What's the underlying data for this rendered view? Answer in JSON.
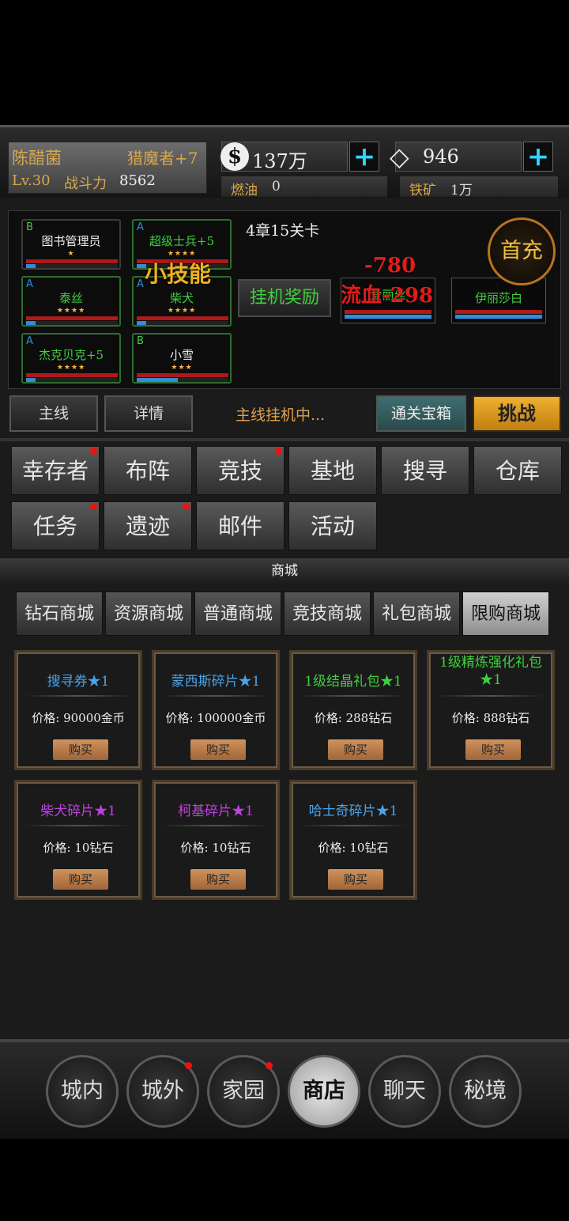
{
  "player": {
    "name": "陈醋菌",
    "title": "猎魔者+7",
    "level": "Lv.30",
    "power_label": "战斗力",
    "power_value": "8562"
  },
  "resources": {
    "money": "137万",
    "diamonds": "946",
    "fuel_label": "燃油",
    "fuel_value": "0",
    "iron_label": "铁矿",
    "iron_value": "1万"
  },
  "battle": {
    "stage": "4章15关卡",
    "idle_reward": "挂机奖励",
    "first_charge": "首充",
    "skill_popup": "小技能",
    "damage_popup": "-780",
    "bleed_popup": "流血-298",
    "heroes": [
      {
        "grade": "B",
        "name": "图书管理员",
        "stars": "★",
        "mp": 0.1
      },
      {
        "grade": "A",
        "name": "超级士兵+5",
        "stars": "★★★★",
        "mp": 0.1
      },
      {
        "grade": "A",
        "name": "泰丝",
        "stars": "★★★★",
        "mp": 0.1
      },
      {
        "grade": "A",
        "name": "柴犬",
        "stars": "★★★★",
        "mp": 0.1
      },
      {
        "grade": "A",
        "name": "杰克贝克+5",
        "stars": "★★★★",
        "mp": 0.1
      },
      {
        "grade": "B",
        "name": "小雪",
        "stars": "★★★",
        "mp": 0.45
      }
    ],
    "enemies": [
      {
        "name": "爱丽丝"
      },
      {
        "name": "伊丽莎白"
      }
    ]
  },
  "action_bar": {
    "main_line": "主线",
    "details": "详情",
    "status": "主线挂机中...",
    "clear_chest": "通关宝箱",
    "challenge": "挑战"
  },
  "menu": [
    {
      "label": "幸存者",
      "dot": true
    },
    {
      "label": "布阵",
      "dot": false
    },
    {
      "label": "竞技",
      "dot": true
    },
    {
      "label": "基地",
      "dot": false
    },
    {
      "label": "搜寻",
      "dot": false
    },
    {
      "label": "仓库",
      "dot": false
    },
    {
      "label": "任务",
      "dot": true
    },
    {
      "label": "遗迹",
      "dot": true
    },
    {
      "label": "邮件",
      "dot": false
    },
    {
      "label": "活动",
      "dot": false
    }
  ],
  "shop": {
    "title": "商城",
    "tabs": [
      "钻石商城",
      "资源商城",
      "普通商城",
      "竞技商城",
      "礼包商城",
      "限购商城"
    ],
    "active_tab": 5,
    "price_label": "价格:",
    "buy_label": "购买",
    "items": [
      {
        "name": "搜寻券★1",
        "price": "90000金币",
        "color": "#4aa3e8"
      },
      {
        "name": "蒙西斯碎片★1",
        "price": "100000金币",
        "color": "#4aa3e8"
      },
      {
        "name": "1级结晶礼包★1",
        "price": "288钻石",
        "color": "#3ed13e"
      },
      {
        "name": "1级精炼强化礼包★1",
        "price": "888钻石",
        "color": "#3ed13e"
      },
      {
        "name": "柴犬碎片★1",
        "price": "10钻石",
        "color": "#c040e0"
      },
      {
        "name": "柯基碎片★1",
        "price": "10钻石",
        "color": "#c040e0"
      },
      {
        "name": "哈士奇碎片★1",
        "price": "10钻石",
        "color": "#4aa3e8"
      }
    ]
  },
  "nav": [
    {
      "label": "城内",
      "dot": false
    },
    {
      "label": "城外",
      "dot": true
    },
    {
      "label": "家园",
      "dot": true
    },
    {
      "label": "商店",
      "dot": false
    },
    {
      "label": "聊天",
      "dot": false
    },
    {
      "label": "秘境",
      "dot": false
    }
  ],
  "nav_active": 3
}
